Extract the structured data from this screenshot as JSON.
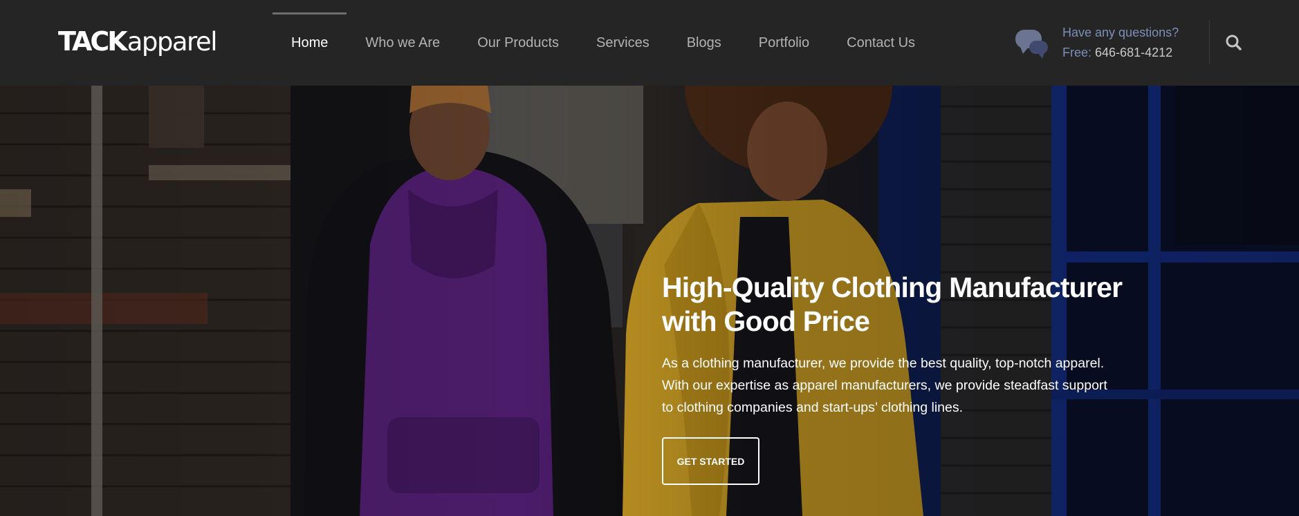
{
  "brand": {
    "logo_bold": "TACK",
    "logo_light": "apparel"
  },
  "nav": {
    "items": [
      {
        "label": "Home",
        "active": true
      },
      {
        "label": "Who we Are",
        "active": false
      },
      {
        "label": "Our Products",
        "active": false
      },
      {
        "label": "Services",
        "active": false
      },
      {
        "label": "Blogs",
        "active": false
      },
      {
        "label": "Portfolio",
        "active": false
      },
      {
        "label": "Contact Us",
        "active": false
      }
    ]
  },
  "contact": {
    "question": "Have any questions?",
    "free_label": "Free:",
    "phone": "646-681-4212",
    "icon": "chat-bubbles-icon"
  },
  "search": {
    "icon": "search-icon"
  },
  "hero": {
    "title_line1": "High-Quality Clothing Manufacturer",
    "title_line2": "with Good Price",
    "desc_line1": "As a clothing manufacturer, we provide the best quality, top-notch apparel.",
    "desc_line2": "With our expertise as apparel manufacturers, we provide steadfast support",
    "desc_line3": "to clothing companies and start-ups’ clothing lines.",
    "cta_label": "GET STARTED"
  },
  "colors": {
    "header_bg": "#252525",
    "nav_text": "#b3b3b3",
    "nav_active": "#ffffff",
    "contact_accent": "#7d8fb8",
    "hoodie_purple": "#4e1d6e",
    "coat_yellow": "#c99a24",
    "wall_blue": "#10287a"
  }
}
